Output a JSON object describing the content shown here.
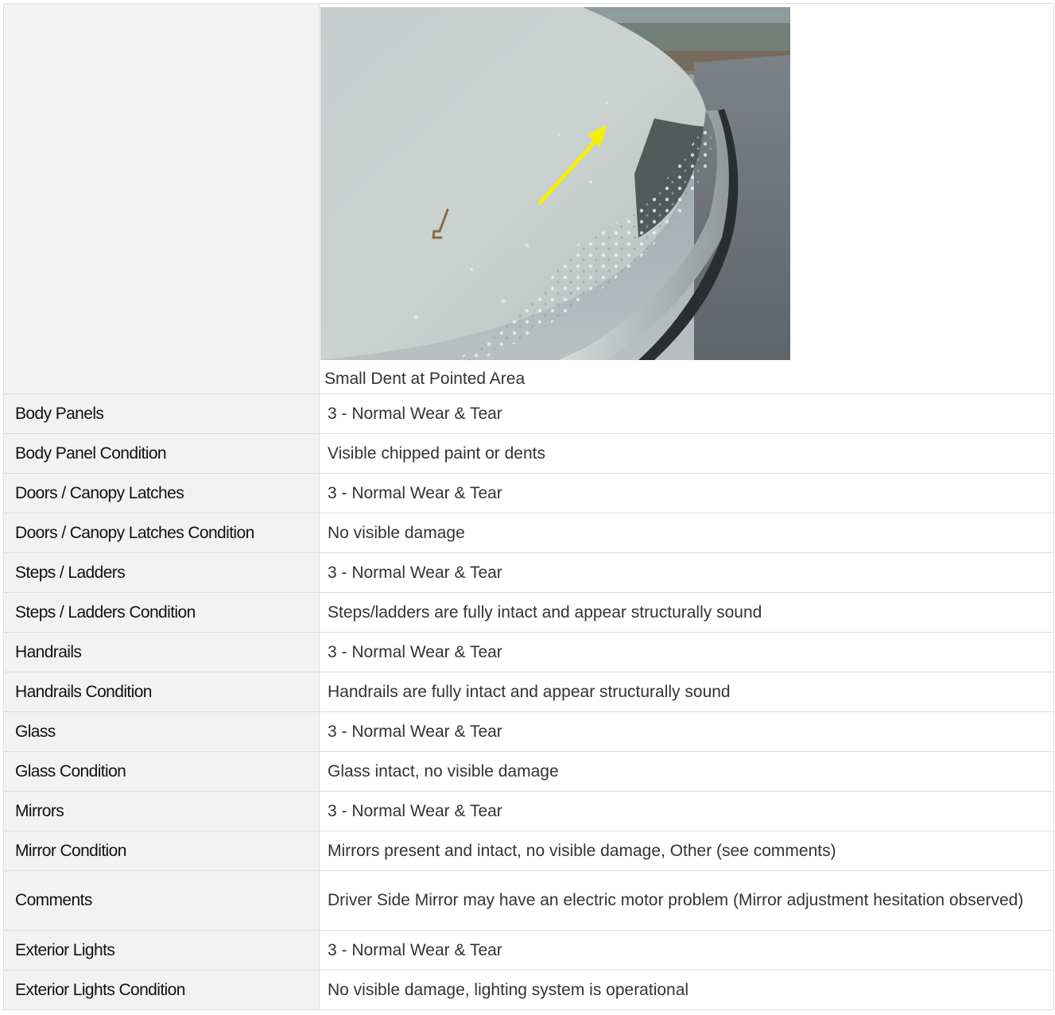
{
  "photo": {
    "caption": "Small Dent at Pointed Area",
    "description": "vehicle-body-panel-with-rain-droplets-and-yellow-arrow"
  },
  "rows": [
    {
      "label": "Body Panels",
      "value": "3 - Normal Wear & Tear"
    },
    {
      "label": "Body Panel Condition",
      "value": "Visible chipped paint or dents"
    },
    {
      "label": "Doors / Canopy Latches",
      "value": "3 - Normal Wear & Tear"
    },
    {
      "label": "Doors / Canopy Latches Condition",
      "value": "No visible damage"
    },
    {
      "label": "Steps / Ladders",
      "value": "3 - Normal Wear & Tear"
    },
    {
      "label": "Steps / Ladders Condition",
      "value": "Steps/ladders are fully intact and appear structurally sound"
    },
    {
      "label": "Handrails",
      "value": "3 - Normal Wear & Tear"
    },
    {
      "label": "Handrails Condition",
      "value": "Handrails are fully intact and appear structurally sound"
    },
    {
      "label": "Glass",
      "value": "3 - Normal Wear & Tear"
    },
    {
      "label": "Glass Condition",
      "value": "Glass intact, no visible damage"
    },
    {
      "label": "Mirrors",
      "value": "3 - Normal Wear & Tear"
    },
    {
      "label": "Mirror Condition",
      "value": "Mirrors present and intact, no visible damage, Other (see comments)"
    },
    {
      "label": "Comments",
      "value": "Driver Side Mirror may have an electric motor problem (Mirror adjustment hesitation observed)"
    },
    {
      "label": "Exterior Lights",
      "value": "3 - Normal Wear & Tear"
    },
    {
      "label": "Exterior Lights Condition",
      "value": "No visible damage, lighting system is operational"
    }
  ],
  "colors": {
    "label_background": "#f2f2f2",
    "border": "#dddddd",
    "arrow": "#f5f000"
  }
}
